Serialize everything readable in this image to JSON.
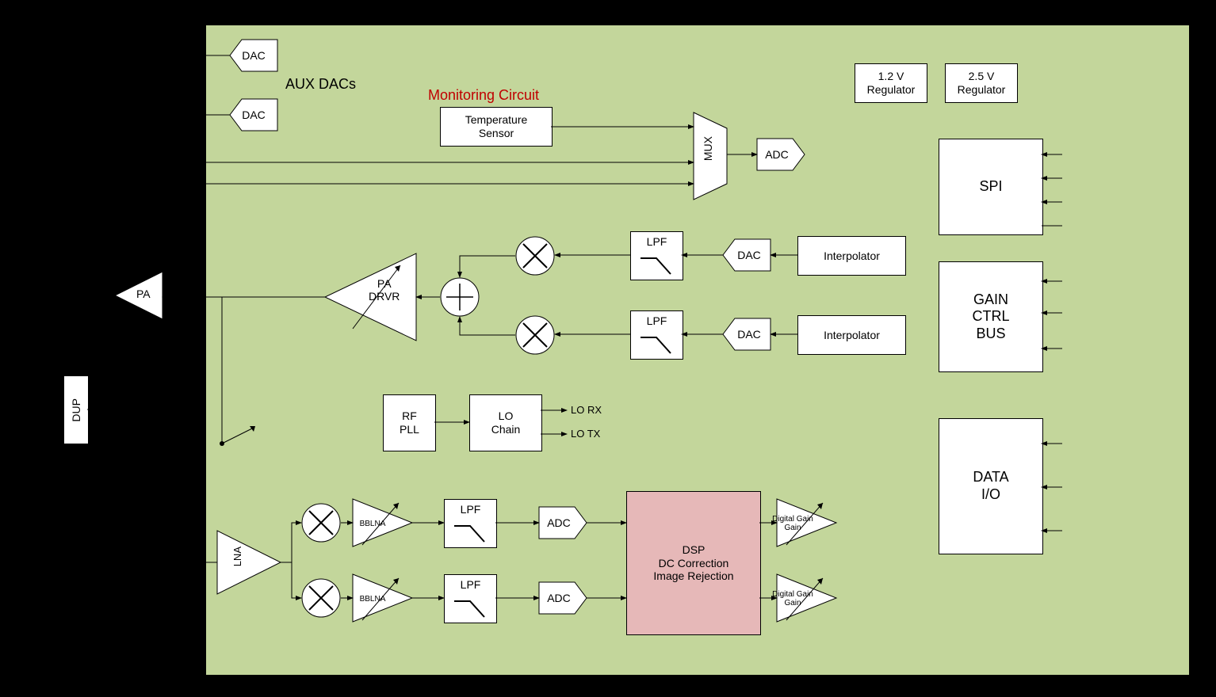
{
  "labels": {
    "aux_dacs": "AUX DACs",
    "monitoring": "Monitoring Circuit",
    "dup": "DUP",
    "pa": "PA",
    "lna": "LNA",
    "lo_rx": "LO RX",
    "lo_tx": "LO TX"
  },
  "blocks": {
    "dac1": "DAC",
    "dac2": "DAC",
    "temp_sensor": "Temperature\nSensor",
    "mux": "MUX",
    "adc_mon": "ADC",
    "reg12": "1.2 V\nRegulator",
    "reg25": "2.5 V\nRegulator",
    "spi": "SPI",
    "gain_ctrl": "GAIN\nCTRL\nBUS",
    "data_io": "DATA\nI/O",
    "pa_drvr": "PA\nDRVR",
    "lpf1": "LPF",
    "lpf2": "LPF",
    "dac_tx1": "DAC",
    "dac_tx2": "DAC",
    "interp1": "Interpolator",
    "interp2": "Interpolator",
    "rf_pll": "RF\nPLL",
    "lo_chain": "LO\nChain",
    "bblna1": "BBLNA",
    "bblna2": "BBLNA",
    "lpf_rx1": "LPF",
    "lpf_rx2": "LPF",
    "adc_rx1": "ADC",
    "adc_rx2": "ADC",
    "dsp": "DSP\nDC Correction\nImage Rejection",
    "dgain1": "Digital\nGain",
    "dgain2": "Digital\nGain"
  }
}
